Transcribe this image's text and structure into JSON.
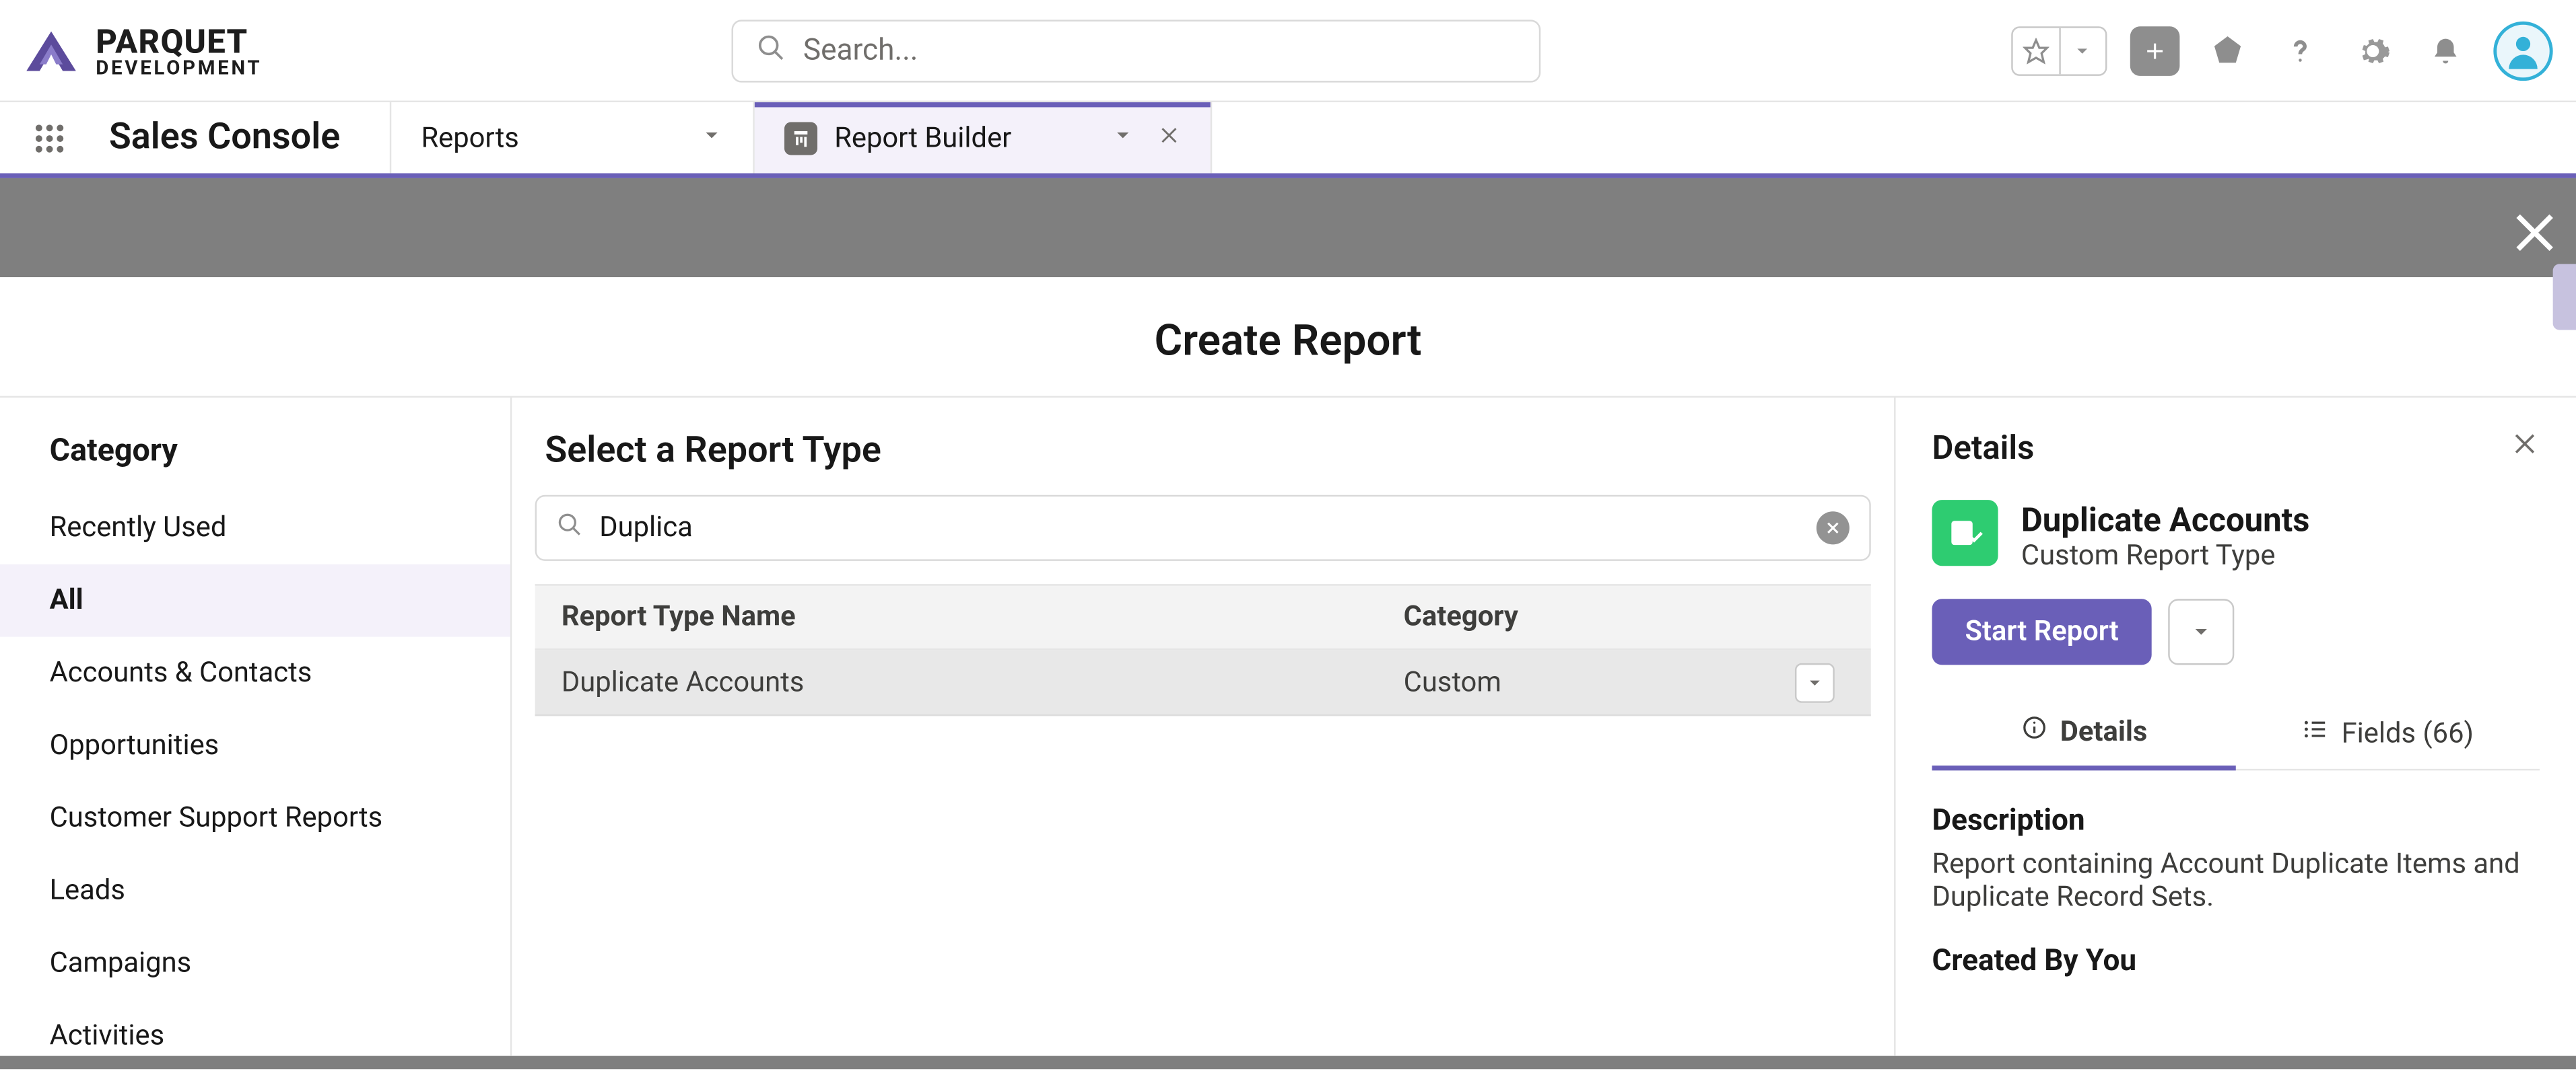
{
  "header": {
    "brand_line1": "PARQUET",
    "brand_line2": "DEVELOPMENT",
    "search_placeholder": "Search..."
  },
  "context": {
    "app_name": "Sales Console",
    "tabs": [
      {
        "label": "Reports"
      },
      {
        "label": "Report Builder"
      }
    ]
  },
  "modal": {
    "title": "Create Report",
    "category_heading": "Category",
    "categories": [
      "Recently Used",
      "All",
      "Accounts & Contacts",
      "Opportunities",
      "Customer Support Reports",
      "Leads",
      "Campaigns",
      "Activities"
    ],
    "selected_category_index": 1,
    "list_heading": "Select a Report Type",
    "search_value": "Duplica",
    "columns": {
      "name": "Report Type Name",
      "category": "Category"
    },
    "rows": [
      {
        "name": "Duplicate Accounts",
        "category": "Custom"
      }
    ]
  },
  "details": {
    "panel_heading": "Details",
    "title": "Duplicate Accounts",
    "subtitle": "Custom Report Type",
    "start_label": "Start Report",
    "tab_details": "Details",
    "tab_fields": "Fields (66)",
    "desc_heading": "Description",
    "desc_body": "Report containing Account Duplicate Items and Duplicate Record Sets.",
    "created_heading": "Created By You"
  }
}
